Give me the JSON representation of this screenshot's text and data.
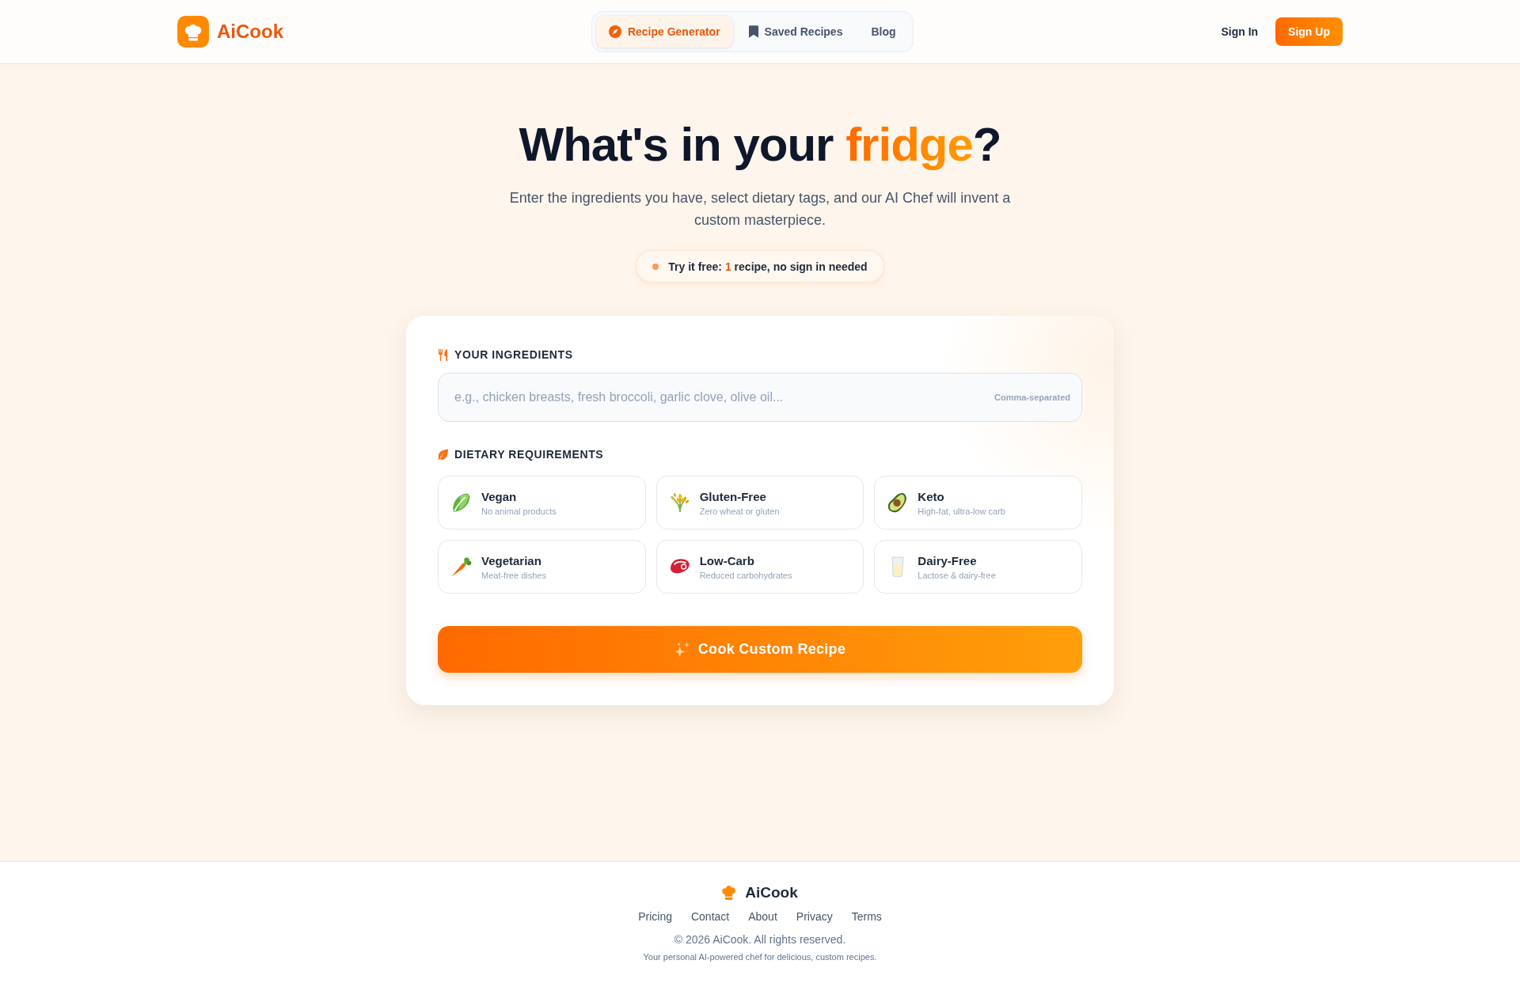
{
  "header": {
    "logo": "AiCook",
    "nav": [
      {
        "label": "Recipe Generator",
        "selected": true
      },
      {
        "label": "Saved Recipes",
        "selected": false
      },
      {
        "label": "Blog",
        "selected": false
      }
    ],
    "sign_in": "Sign In",
    "sign_up": "Sign Up"
  },
  "hero": {
    "title": "What's in your **fridge**?",
    "subtitle": "Enter the ingredients you have, select dietary tags, and our AI Chef will invent a custom masterpiece.",
    "badge": "Try it free: **1** recipe, no sign in needed"
  },
  "form": {
    "ingredients": {
      "label": "YOUR INGREDIENTS",
      "placeholder": "e.g., chicken breasts, fresh broccoli, garlic clove, olive oil...",
      "hint": "Comma-separated"
    },
    "dietary": {
      "label": "DIETARY REQUIREMENTS",
      "options": [
        {
          "name": "Vegan",
          "description": "No animal products",
          "selected": false
        },
        {
          "name": "Gluten-Free",
          "description": "Zero wheat or gluten",
          "selected": false
        },
        {
          "name": "Keto",
          "description": "High-fat, ultra-low carb",
          "selected": false
        },
        {
          "name": "Vegetarian",
          "description": "Meat-free dishes",
          "selected": false
        },
        {
          "name": "Low-Carb",
          "description": "Reduced carbohydrates",
          "selected": false
        },
        {
          "name": "Dairy-Free",
          "description": "Lactose & dairy-free",
          "selected": false
        }
      ]
    },
    "submit": "Cook Custom Recipe"
  },
  "footer": {
    "logo": "AiCook",
    "links": [
      "Pricing",
      "Contact",
      "About",
      "Privacy",
      "Terms"
    ],
    "copyright": "© 2026 AiCook. All rights reserved.",
    "tagline": "Your personal AI-powered chef for delicious, custom recipes."
  }
}
